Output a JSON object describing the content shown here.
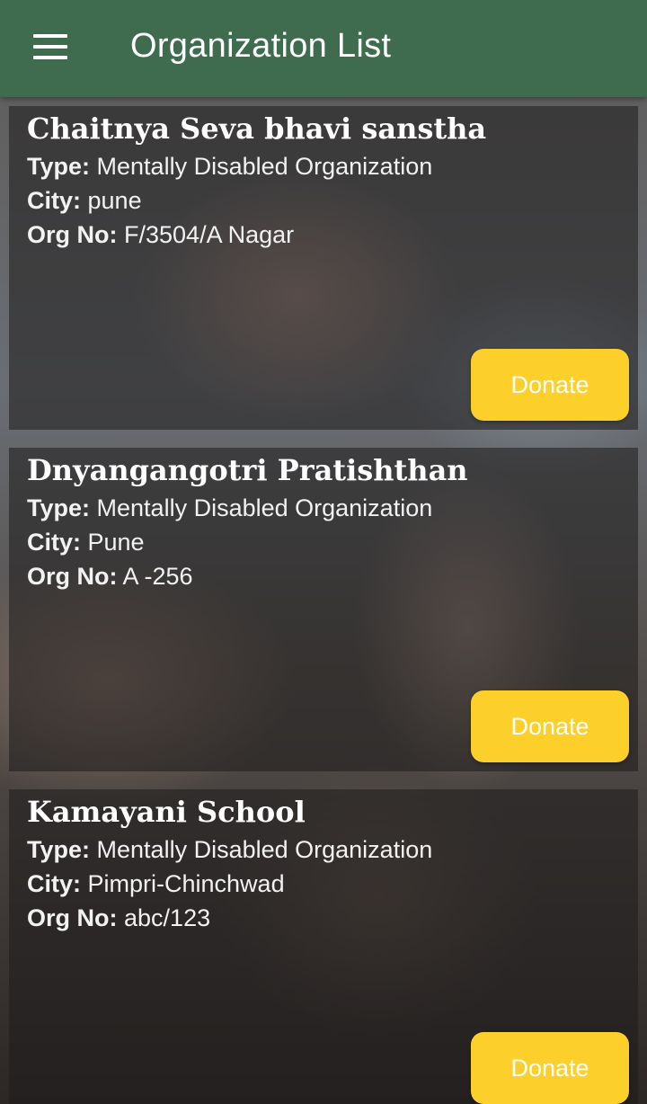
{
  "appbar": {
    "title": "Organization List",
    "menu_icon": "hamburger-menu-icon"
  },
  "labels": {
    "type": "Type:",
    "city": "City:",
    "org_no": "Org No:"
  },
  "organizations": [
    {
      "name": "Chaitnya Seva bhavi sanstha",
      "type": "Mentally Disabled Organization",
      "city": "pune",
      "org_no": "F/3504/A Nagar",
      "donate_label": "Donate"
    },
    {
      "name": "Dnyangangotri Pratishthan",
      "type": "Mentally Disabled Organization",
      "city": "Pune",
      "org_no": "A -256",
      "donate_label": "Donate"
    },
    {
      "name": "Kamayani School",
      "type": "Mentally Disabled Organization",
      "city": "Pimpri-Chinchwad",
      "org_no": "abc/123",
      "donate_label": "Donate"
    }
  ],
  "colors": {
    "appbar": "#3f6b4f",
    "donate_button": "#fdcf2b",
    "text": "#ffffff"
  }
}
